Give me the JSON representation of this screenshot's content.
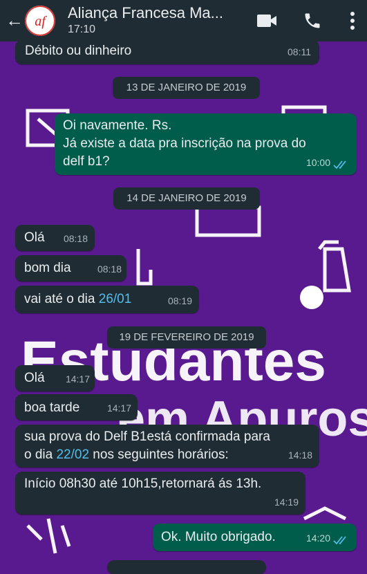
{
  "header": {
    "title": "Aliança Francesa Ma...",
    "status": "17:10",
    "avatar_text": "af"
  },
  "messages": [
    {
      "text": "Débito ou dinheiro",
      "time": "08:11"
    },
    {
      "date": "13 DE JANEIRO DE 2019"
    },
    {
      "text1": "Oi navamente. Rs.",
      "text2": "Já existe a data pra inscrição na prova do",
      "text3": "delf b1?",
      "time": "10:00"
    },
    {
      "date": "14 DE JANEIRO DE 2019"
    },
    {
      "text": "Olá",
      "time": "08:18"
    },
    {
      "text": "bom dia",
      "time": "08:18"
    },
    {
      "text_pre": "vai até o dia ",
      "link": "26/01",
      "time": "08:19"
    },
    {
      "date": "19 DE FEVEREIRO DE 2019"
    },
    {
      "text": "Olá",
      "time": "14:17"
    },
    {
      "text": "boa tarde",
      "time": "14:17"
    },
    {
      "text1": "sua prova do Delf B1está confirmada para",
      "text2_pre": "o dia ",
      "link": "22/02",
      "text2_post": " nos seguintes horários:",
      "time": "14:18"
    },
    {
      "text": "Início 08h30 até 10h15,retornará ás 13h.",
      "time": "14:19"
    },
    {
      "text": "Ok. Muito obrigado.",
      "time": "14:20"
    }
  ],
  "wallpaper": {
    "line1": "Estudantes",
    "line2": "em Apuros"
  },
  "colors": {
    "header": "#1f2c33",
    "incoming": "#1f2c33",
    "outgoing": "#005c4b",
    "wallpaper": "#5a1a8f",
    "link": "#53bdeb"
  }
}
